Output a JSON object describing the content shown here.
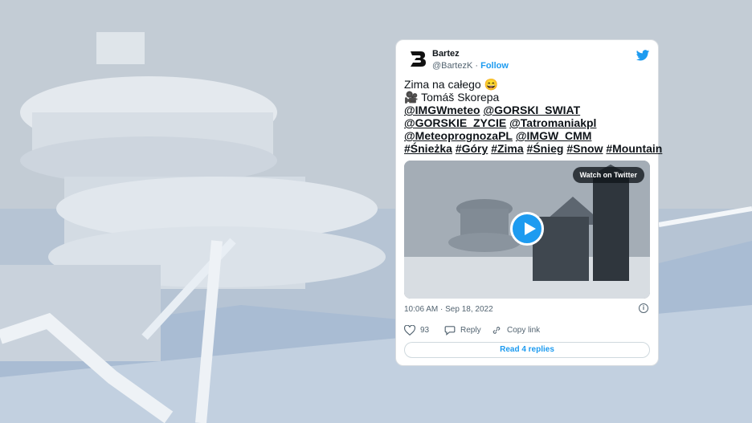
{
  "tweet": {
    "display_name": "Bartez",
    "handle": "@BartezK",
    "separator": "·",
    "follow_label": "Follow",
    "lines": [
      {
        "parts": [
          {
            "t": "Zima na całego 😄",
            "m": false
          }
        ]
      },
      {
        "parts": [
          {
            "t": "🎥 Tomáš Skorepa",
            "m": false
          }
        ]
      },
      {
        "parts": [
          {
            "t": "@IMGWmeteo",
            "m": true
          },
          {
            "t": " ",
            "m": false
          },
          {
            "t": "@GORSKI_SWIAT",
            "m": true
          }
        ]
      },
      {
        "parts": [
          {
            "t": "@GORSKIE_ZYCIE",
            "m": true
          },
          {
            "t": " ",
            "m": false
          },
          {
            "t": "@Tatromaniakpl",
            "m": true
          }
        ]
      },
      {
        "parts": [
          {
            "t": "@MeteoprognozaPL",
            "m": true
          },
          {
            "t": " ",
            "m": false
          },
          {
            "t": "@IMGW_CMM",
            "m": true
          }
        ]
      },
      {
        "parts": [
          {
            "t": "#Śnieżka",
            "m": true
          },
          {
            "t": " ",
            "m": false
          },
          {
            "t": "#Góry",
            "m": true
          },
          {
            "t": " ",
            "m": false
          },
          {
            "t": "#Zima",
            "m": true
          },
          {
            "t": " ",
            "m": false
          },
          {
            "t": "#Śnieg",
            "m": true
          },
          {
            "t": " ",
            "m": false
          },
          {
            "t": "#Snow",
            "m": true
          },
          {
            "t": " ",
            "m": false
          },
          {
            "t": "#Mountain",
            "m": true
          }
        ]
      }
    ],
    "watch_label": "Watch on Twitter",
    "timestamp": "10:06 AM · Sep 18, 2022",
    "likes": "93",
    "reply_label": "Reply",
    "copy_link_label": "Copy link",
    "read_replies_label": "Read 4 replies",
    "info_glyph": "i"
  },
  "colors": {
    "accent": "#1d9bf0",
    "text": "#0f1419",
    "muted": "#536471"
  }
}
